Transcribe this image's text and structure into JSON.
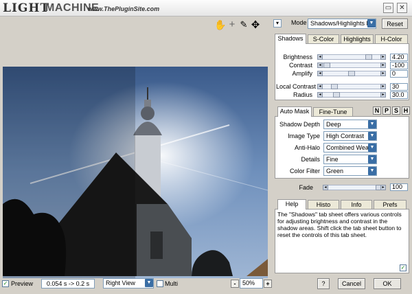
{
  "app": {
    "logo_light": "LIGHT",
    "logo_machine": "MACHINE",
    "url": "www.ThePluginSite.com"
  },
  "window_buttons": {
    "minimize": "▭",
    "close": "✕"
  },
  "tools": {
    "hand": "✋",
    "crosshair": "+",
    "eyedropper": "✎",
    "move": "✥"
  },
  "mode": {
    "label": "Mode",
    "value": "Shadows/Highlights Pro",
    "reset": "Reset",
    "menu_arrow": "▾"
  },
  "tabs_top": [
    "Shadows",
    "S-Color",
    "Highlights",
    "H-Color"
  ],
  "sliders": [
    {
      "label": "Brightness",
      "value": "4.20",
      "level": 0.85
    },
    {
      "label": "Contrast",
      "value": "-100",
      "level": 0.0
    },
    {
      "label": "Amplify",
      "value": "0",
      "level": 0.5
    },
    {
      "label": "Local Contrast",
      "value": "30",
      "level": 0.15
    },
    {
      "label": "Radius",
      "value": "30.0",
      "level": 0.2
    }
  ],
  "tabs_mid": [
    "Auto Mask",
    "Fine-Tune"
  ],
  "mini_buttons": [
    "N",
    "P",
    "S",
    "H"
  ],
  "selects": [
    {
      "label": "Shadow Depth",
      "value": "Deep"
    },
    {
      "label": "Image Type",
      "value": "High Contrast"
    },
    {
      "label": "Anti-Halo",
      "value": "Combined Weak"
    },
    {
      "label": "Details",
      "value": "Fine"
    },
    {
      "label": "Color Filter",
      "value": "Green"
    }
  ],
  "fade": {
    "label": "Fade",
    "value": "100",
    "level": 0.95
  },
  "tabs_bottom": [
    "Help",
    "Histo",
    "Info",
    "Prefs"
  ],
  "help_text": "The \"Shadows\" tab sheet offers various controls for adjusting brightness and contrast in the shadow areas. Shift click the tab sheet button to reset the controls of this tab sheet.",
  "bottom": {
    "preview": "Preview",
    "timing": "0.054 s -> 0.2 s",
    "view": "Right View",
    "multi": "Multi",
    "zoom_minus": "-",
    "zoom": "50%",
    "zoom_plus": "+",
    "help": "?",
    "cancel": "Cancel",
    "ok": "OK"
  }
}
